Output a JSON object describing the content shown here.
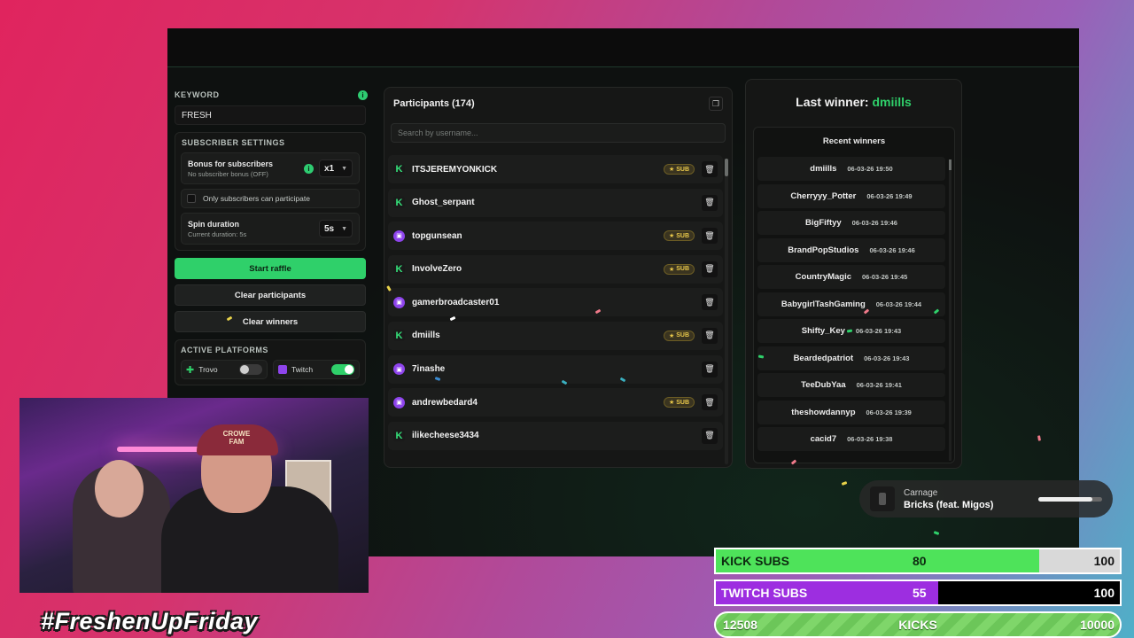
{
  "keyword": {
    "label": "KEYWORD",
    "value": "FRESH",
    "info_icon": "i"
  },
  "subscriber_settings": {
    "label": "SUBSCRIBER SETTINGS",
    "bonus_title": "Bonus for subscribers",
    "bonus_sub": "No subscriber bonus (OFF)",
    "bonus_value": "x1",
    "only_subs_label": "Only subscribers can participate",
    "spin_title": "Spin duration",
    "spin_sub": "Current duration: 5s",
    "spin_value": "5s"
  },
  "buttons": {
    "start": "Start raffle",
    "clear_participants": "Clear participants",
    "clear_winners": "Clear winners"
  },
  "platforms": {
    "label": "ACTIVE PLATFORMS",
    "items": [
      {
        "name": "Trovo",
        "on": false
      },
      {
        "name": "Twitch",
        "on": true
      }
    ]
  },
  "participants": {
    "title": "Participants (174)",
    "search_placeholder": "Search by username...",
    "sub_label": "SUB",
    "rows": [
      {
        "name": "ITSJEREMYONKICK",
        "platform": "kick",
        "sub": true
      },
      {
        "name": "Ghost_serpant",
        "platform": "kick",
        "sub": false
      },
      {
        "name": "topgunsean",
        "platform": "twitch",
        "sub": true
      },
      {
        "name": "InvolveZero",
        "platform": "kick",
        "sub": true
      },
      {
        "name": "gamerbroadcaster01",
        "platform": "twitch",
        "sub": false
      },
      {
        "name": "dmiills",
        "platform": "kick",
        "sub": true
      },
      {
        "name": "7inashe",
        "platform": "twitch",
        "sub": false
      },
      {
        "name": "andrewbedard4",
        "platform": "twitch",
        "sub": true
      },
      {
        "name": "ilikecheese3434",
        "platform": "kick",
        "sub": false
      }
    ]
  },
  "winners": {
    "last_label": "Last winner:",
    "last_name": "dmiills",
    "recent_title": "Recent winners",
    "rows": [
      {
        "name": "dmiills",
        "time": "06-03-26 19:50"
      },
      {
        "name": "Cherryyy_Potter",
        "time": "06-03-26 19:49"
      },
      {
        "name": "BigFiftyy",
        "time": "06-03-26 19:46"
      },
      {
        "name": "BrandPopStudios",
        "time": "06-03-26 19:46"
      },
      {
        "name": "CountryMagic",
        "time": "06-03-26 19:45"
      },
      {
        "name": "BabygirlTashGaming",
        "time": "06-03-26 19:44"
      },
      {
        "name": "Shifty_Key",
        "time": "06-03-26 19:43"
      },
      {
        "name": "Beardedpatriot",
        "time": "06-03-26 19:43"
      },
      {
        "name": "TeeDubYaa",
        "time": "06-03-26 19:41"
      },
      {
        "name": "theshowdannyp",
        "time": "06-03-26 19:39"
      },
      {
        "name": "cacid7",
        "time": "06-03-26 19:38"
      }
    ]
  },
  "webcam": {
    "cap_text": "CROWE FAM"
  },
  "overlay": {
    "hashtag": "#FreshenUpFriday",
    "now_playing": {
      "artist": "Carnage",
      "track": "Bricks (feat. Migos)",
      "progress": 0.85
    },
    "goals": [
      {
        "id": "kick",
        "label": "KICK SUBS",
        "current": "80",
        "target": "100",
        "fraction": 0.8
      },
      {
        "id": "twitch",
        "label": "TWITCH SUBS",
        "current": "55",
        "target": "100",
        "fraction": 0.55
      },
      {
        "id": "kicks",
        "label": "KICKS",
        "current": "12508",
        "target": "10000",
        "fraction": 1.0
      }
    ]
  },
  "colors": {
    "accent": "#2fd06a",
    "kick": "#35e27a",
    "twitch": "#8e44ec",
    "sub_badge": "#e9c84a"
  }
}
